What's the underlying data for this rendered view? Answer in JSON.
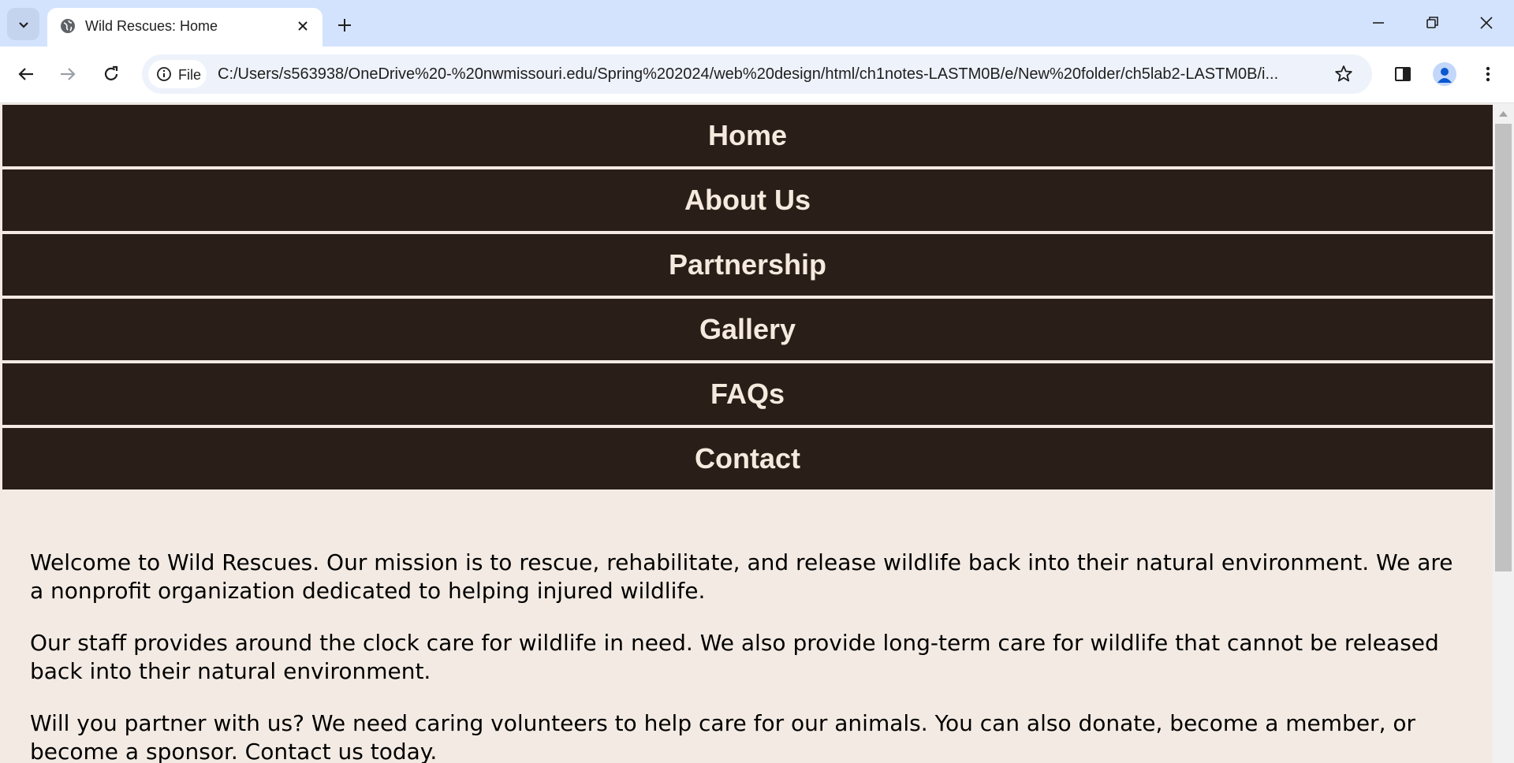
{
  "browser": {
    "tab_title": "Wild Rescues: Home",
    "omnibox_chip": "File",
    "url": "C:/Users/s563938/OneDrive%20-%20nwmissouri.edu/Spring%202024/web%20design/html/ch1notes-LASTM0B/e/New%20folder/ch5lab2-LASTM0B/i...",
    "icons": {
      "tab_search": "chevron-down-icon",
      "favicon": "globe-icon",
      "close_tab": "close-icon",
      "new_tab": "plus-icon",
      "minimize": "minimize-icon",
      "restore": "restore-icon",
      "close_window": "close-icon",
      "back": "back-arrow-icon",
      "forward": "forward-arrow-icon",
      "reload": "reload-icon",
      "site_info": "info-icon",
      "bookmark": "star-icon",
      "side_panel": "side-panel-icon",
      "profile": "person-icon",
      "menu": "kebab-menu-icon"
    }
  },
  "nav": {
    "items": [
      {
        "label": "Home"
      },
      {
        "label": "About Us"
      },
      {
        "label": "Partnership"
      },
      {
        "label": "Gallery"
      },
      {
        "label": "FAQs"
      },
      {
        "label": "Contact"
      }
    ]
  },
  "main": {
    "paragraphs": [
      "Welcome to Wild Rescues. Our mission is to rescue, rehabilitate, and release wildlife back into their natural environment. We are a nonprofit organization dedicated to helping injured wildlife.",
      "Our staff provides around the clock care for wildlife in need. We also provide long-term care for wildlife that cannot be released back into their natural environment.",
      "Will you partner with us? We need caring volunteers to help care for our animals. You can also donate, become a member, or become a sponsor. Contact us today."
    ]
  },
  "colors": {
    "nav_background": "#2a1f18",
    "nav_text": "#f6eadf",
    "page_background": "#f3ebe3",
    "tabstrip_background": "#d3e3fd"
  }
}
